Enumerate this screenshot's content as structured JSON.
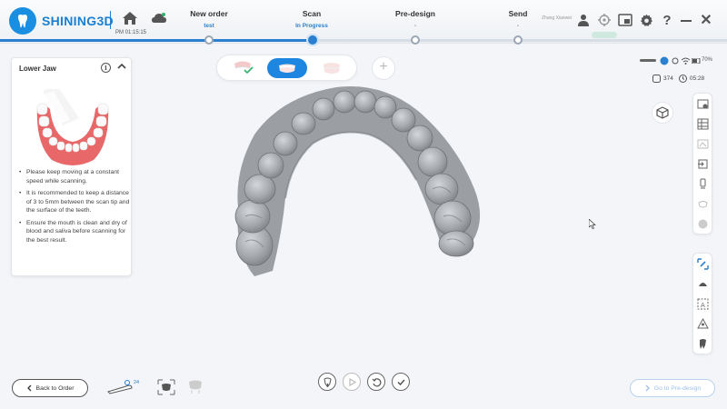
{
  "app": {
    "name": "SHINING3D"
  },
  "header": {
    "time": "PM 01:15:15",
    "user_name": "Zhang Xiaowei",
    "steps": [
      {
        "label": "New order",
        "sub": "test",
        "state": "done"
      },
      {
        "label": "Scan",
        "sub": "In Progress",
        "state": "active"
      },
      {
        "label": "Pre-design",
        "sub": "-",
        "state": "pending"
      },
      {
        "label": "Send",
        "sub": "-",
        "state": "pending"
      }
    ],
    "icons": [
      "home-icon",
      "cloud-sync-icon",
      "user-icon",
      "calibrate-icon",
      "screenshot-icon",
      "settings-icon",
      "help-icon",
      "minimize-icon",
      "close-icon"
    ]
  },
  "left_panel": {
    "title": "Lower Jaw",
    "tips": [
      "Please keep moving at a constant speed while scanning.",
      "It is recommended to keep a distance of 3 to 5mm between the scan tip and the surface of the teeth.",
      "Ensure the mouth is clean and dry of blood and saliva before scanning for the best result."
    ]
  },
  "jaw_tabs": [
    {
      "name": "upper-jaw",
      "state": "done"
    },
    {
      "name": "lower-jaw",
      "state": "active"
    },
    {
      "name": "occlusion",
      "state": "disabled"
    }
  ],
  "status": {
    "battery": "70%",
    "points": "374",
    "elapsed": "05:28"
  },
  "bottom": {
    "back_label": "Back to Order",
    "next_label": "Go to Pre-design",
    "scan_count": "24"
  },
  "colors": {
    "accent": "#1d86e0",
    "model": "#a9acb0",
    "background": "#f3f5f8"
  }
}
